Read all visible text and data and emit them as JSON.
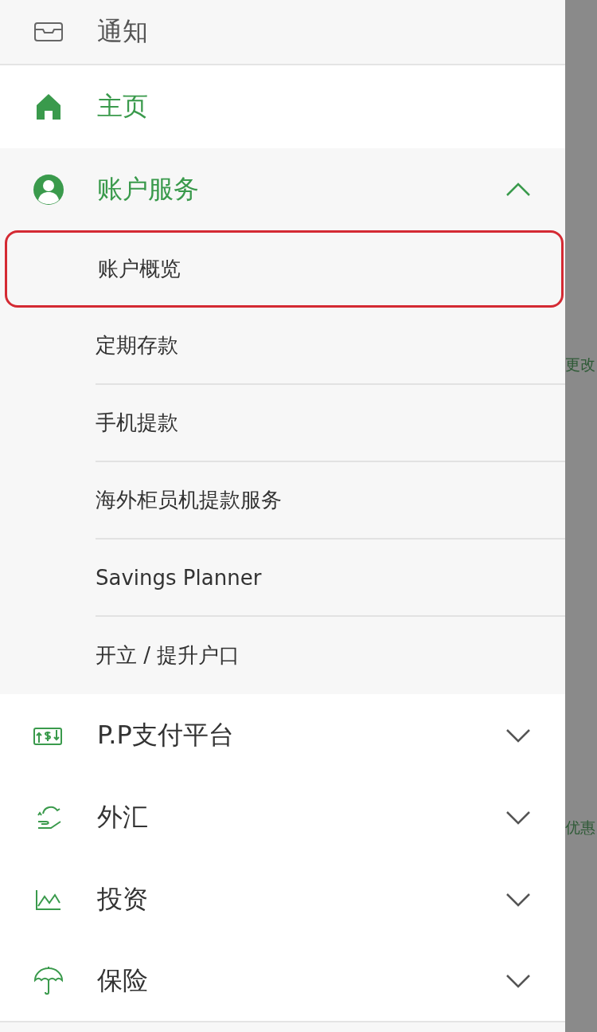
{
  "menu": [
    {
      "label": "通知",
      "kind": "notice",
      "selected": false
    },
    {
      "label": "主页",
      "kind": "link",
      "selected": true
    },
    {
      "label": "账户服务",
      "kind": "group",
      "selected": true,
      "expanded": true,
      "children": [
        {
          "label": "账户概览",
          "highlighted": true
        },
        {
          "label": "定期存款",
          "highlighted": false
        },
        {
          "label": "手机提款",
          "highlighted": false
        },
        {
          "label": "海外柜员机提款服务",
          "highlighted": false
        },
        {
          "label": "Savings Planner",
          "highlighted": false
        },
        {
          "label": "开立 / 提升户口",
          "highlighted": false
        }
      ]
    },
    {
      "label": "P.P支付平台",
      "kind": "group",
      "selected": false,
      "expanded": false
    },
    {
      "label": "外汇",
      "kind": "group",
      "selected": false,
      "expanded": false
    },
    {
      "label": "投资",
      "kind": "group",
      "selected": false,
      "expanded": false
    },
    {
      "label": "保险",
      "kind": "group",
      "selected": false,
      "expanded": false
    }
  ],
  "background_texts": [
    "更改",
    "优惠"
  ]
}
